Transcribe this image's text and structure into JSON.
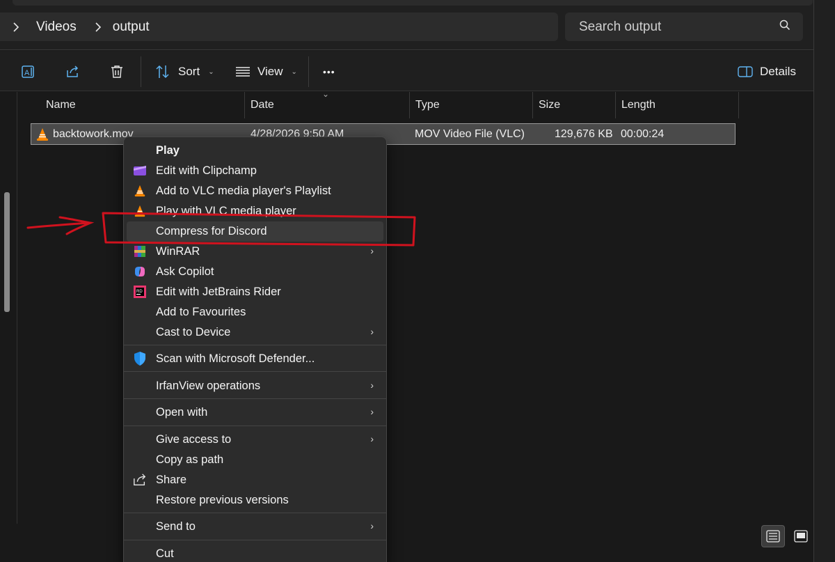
{
  "address": {
    "crumbs": [
      "Videos",
      "output"
    ]
  },
  "search": {
    "placeholder": "Search output"
  },
  "toolbar": {
    "sort_label": "Sort",
    "view_label": "View",
    "more_label": "•••",
    "details_label": "Details"
  },
  "columns": {
    "name": "Name",
    "date": "Date",
    "type": "Type",
    "size": "Size",
    "length": "Length"
  },
  "file": {
    "name": "backtowork.mov",
    "date": "4/28/2026 9:50 AM",
    "type": "MOV Video File (VLC)",
    "size": "129,676 KB",
    "length": "00:00:24"
  },
  "menu": {
    "items": [
      {
        "label": "Play",
        "icon": "none"
      },
      {
        "label": "Edit with Clipchamp",
        "icon": "clipchamp-icon"
      },
      {
        "label": "Add to VLC media player's Playlist",
        "icon": "vlc-icon"
      },
      {
        "label": "Play with VLC media player",
        "icon": "vlc-icon"
      },
      {
        "label": "Compress for Discord",
        "icon": "none"
      },
      {
        "label": "WinRAR",
        "icon": "winrar-icon"
      },
      {
        "label": "Ask Copilot",
        "icon": "copilot-icon"
      },
      {
        "label": "Edit with JetBrains Rider",
        "icon": "rider-icon"
      },
      {
        "label": "Add to Favourites",
        "icon": "none"
      },
      {
        "label": "Cast to Device",
        "icon": "none"
      },
      {
        "label": "Scan with Microsoft Defender...",
        "icon": "defender-icon"
      },
      {
        "label": "IrfanView operations",
        "icon": "none"
      },
      {
        "label": "Open with",
        "icon": "none"
      },
      {
        "label": "Give access to",
        "icon": "none"
      },
      {
        "label": "Copy as path",
        "icon": "none"
      },
      {
        "label": "Share",
        "icon": "share-icon"
      },
      {
        "label": "Restore previous versions",
        "icon": "none"
      },
      {
        "label": "Send to",
        "icon": "none"
      },
      {
        "label": "Cut",
        "icon": "none"
      }
    ]
  },
  "colors": {
    "background": "#191919",
    "menu": "#2c2c2c",
    "annotation": "#d0121e",
    "selection": "#4a4a4a"
  }
}
